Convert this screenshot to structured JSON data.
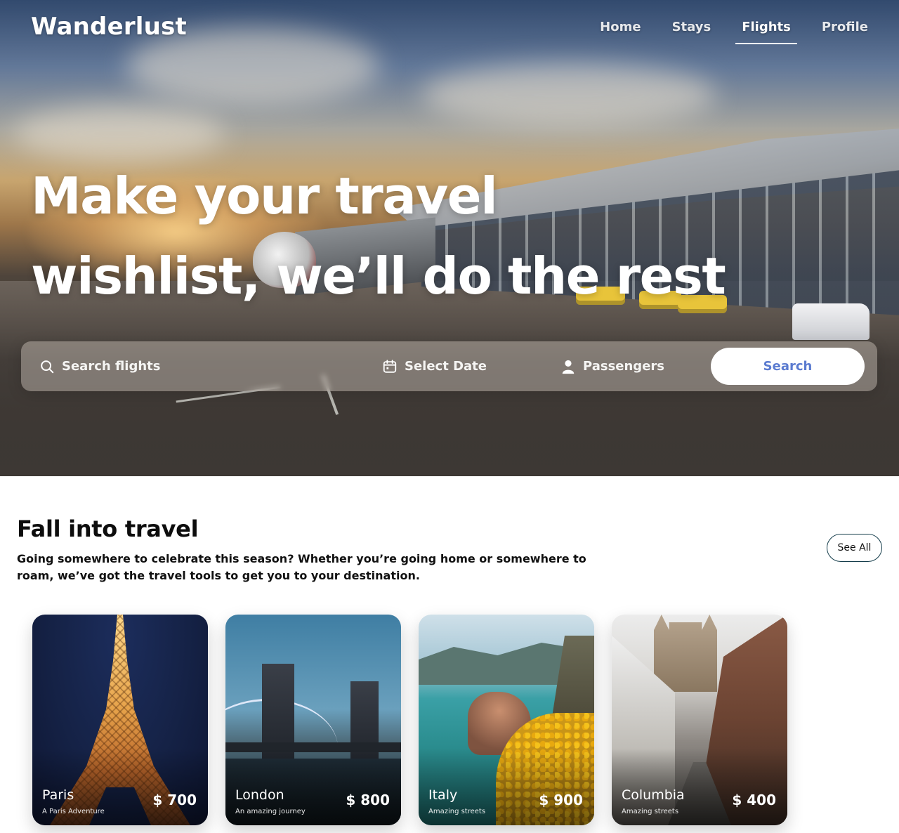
{
  "brand": "Wanderlust",
  "nav": [
    {
      "label": "Home",
      "active": false
    },
    {
      "label": "Stays",
      "active": false
    },
    {
      "label": "Flights",
      "active": true
    },
    {
      "label": "Profile",
      "active": false
    }
  ],
  "hero": {
    "headline_line1": "Make your travel",
    "headline_line2": "wishlist, we’ll do the rest"
  },
  "search": {
    "flights_placeholder": "Search flights",
    "date_placeholder": "Select Date",
    "passengers_placeholder": "Passengers",
    "button_label": "Search",
    "icons": {
      "flights": "search-icon",
      "date": "calendar-icon",
      "passengers": "user-icon"
    }
  },
  "section": {
    "title": "Fall into travel",
    "description": "Going somewhere to celebrate this season? Whether you’re going home or somewhere to roam, we’ve got the travel tools to get you to your destination.",
    "see_all_label": "See All"
  },
  "destinations": [
    {
      "city": "Paris",
      "subtitle": "A Paris Adventure",
      "price": "$ 700"
    },
    {
      "city": "London",
      "subtitle": "An amazing journey",
      "price": "$ 800"
    },
    {
      "city": "Italy",
      "subtitle": "Amazing streets",
      "price": "$ 900"
    },
    {
      "city": "Columbia",
      "subtitle": "Amazing streets",
      "price": "$ 400"
    }
  ],
  "colors": {
    "accent": "#5b7bd0",
    "see_all_border": "#133c4a",
    "text_dark": "#0d0d0d"
  }
}
